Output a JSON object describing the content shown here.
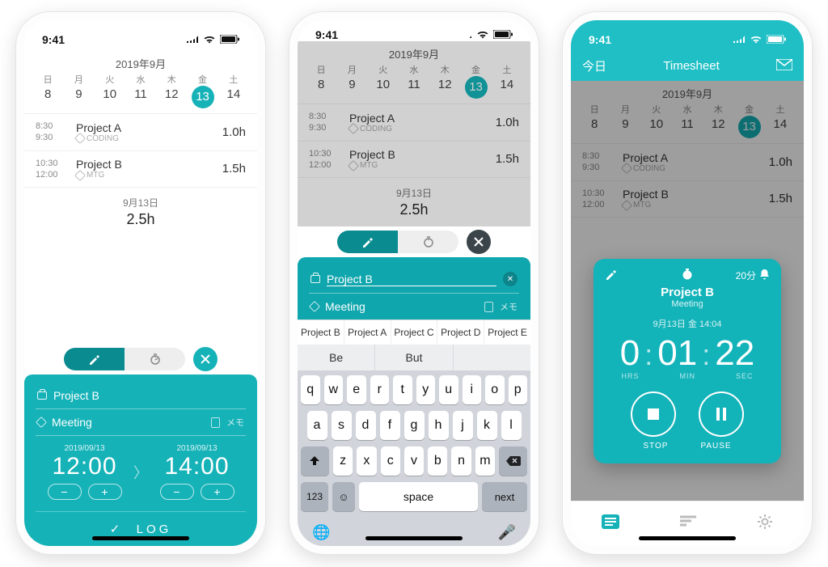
{
  "status": {
    "time": "9:41"
  },
  "calendar": {
    "month": "2019年9月",
    "days": [
      {
        "dow": "日",
        "num": "8"
      },
      {
        "dow": "月",
        "num": "9"
      },
      {
        "dow": "火",
        "num": "10"
      },
      {
        "dow": "水",
        "num": "11"
      },
      {
        "dow": "木",
        "num": "12"
      },
      {
        "dow": "金",
        "num": "13",
        "selected": true
      },
      {
        "dow": "土",
        "num": "14"
      }
    ]
  },
  "entries": [
    {
      "start": "8:30",
      "end": "9:30",
      "title": "Project A",
      "tag": "CODING",
      "dur": "1.0h"
    },
    {
      "start": "10:30",
      "end": "12:00",
      "title": "Project B",
      "tag": "MTG",
      "dur": "1.5h"
    }
  ],
  "summary": {
    "date": "9月13日",
    "total": "2.5h"
  },
  "panel": {
    "project": "Project B",
    "tag": "Meeting",
    "memo": "メモ",
    "from_date": "2019/09/13",
    "from_time": "12:00",
    "to_date": "2019/09/13",
    "to_time": "14:00",
    "log": "LOG"
  },
  "suggestions": [
    "Project B",
    "Project A",
    "Project C",
    "Project D",
    "Project E"
  ],
  "kb_suggestions": [
    "Be",
    "But",
    ""
  ],
  "keyboard": {
    "r1": [
      "q",
      "w",
      "e",
      "r",
      "t",
      "y",
      "u",
      "i",
      "o",
      "p"
    ],
    "r2": [
      "a",
      "s",
      "d",
      "f",
      "g",
      "h",
      "j",
      "k",
      "l"
    ],
    "r3": [
      "z",
      "x",
      "c",
      "v",
      "b",
      "n",
      "m"
    ],
    "num": "123",
    "space": "space",
    "next": "next"
  },
  "screen3": {
    "today": "今日",
    "title": "Timesheet",
    "reminder": "20分",
    "timer_date": "9月13日 金 14:04",
    "hrs": "0",
    "min": "01",
    "sec": "22",
    "lhrs": "HRS",
    "lmin": "MIN",
    "lsec": "SEC",
    "stop": "STOP",
    "pause": "PAUSE"
  }
}
